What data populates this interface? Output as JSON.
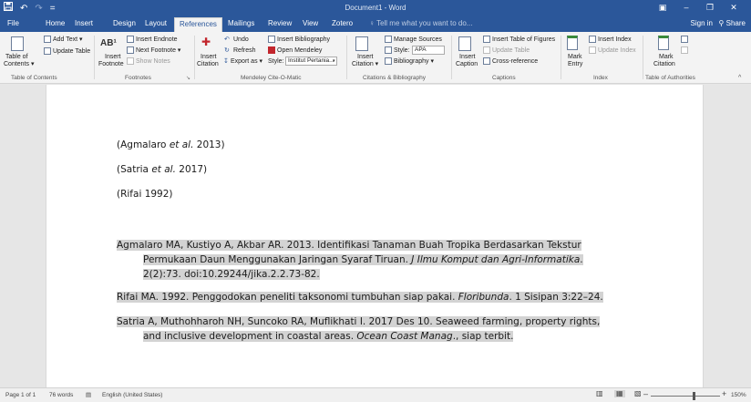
{
  "titlebar": {
    "save_icon": "save-icon",
    "undo_glyph": "↶",
    "redo_glyph": "↷",
    "customize_glyph": "=",
    "title": "Document1 - Word",
    "ribbon_options_glyph": "▣",
    "minimize_glyph": "–",
    "restore_glyph": "❐",
    "close_glyph": "✕"
  },
  "tabs": {
    "items": [
      "File",
      "Home",
      "Insert",
      "Design",
      "Layout",
      "References",
      "Mailings",
      "Review",
      "View",
      "Zotero"
    ],
    "active": "References",
    "tell_me": "Tell me what you want to do...",
    "sign_in": "Sign in",
    "share": "Share"
  },
  "ribbon": {
    "toc": {
      "table_of_contents": "Table of",
      "table_of_contents2": "Contents ▾",
      "add_text": "Add Text ▾",
      "update_table": "Update Table",
      "group_label": "Table of Contents"
    },
    "footnotes": {
      "insert_footnote": "Insert",
      "insert_footnote2": "Footnote",
      "ab_glyph": "AB¹",
      "insert_endnote": "Insert Endnote",
      "next_footnote": "Next Footnote ▾",
      "show_notes": "Show Notes",
      "group_label": "Footnotes"
    },
    "mendeley": {
      "insert_citation": "Insert",
      "insert_citation2": "Citation",
      "undo": "Undo",
      "refresh": "Refresh",
      "export_as": "Export as ▾",
      "insert_bibliography": "Insert Bibliography",
      "open_mendeley": "Open Mendeley",
      "style_label": "Style:",
      "style_value": "Institut Pertania...",
      "group_label": "Mendeley Cite-O-Matic"
    },
    "citations": {
      "insert_citation": "Insert",
      "insert_citation2": "Citation ▾",
      "manage_sources": "Manage Sources",
      "style_label": "Style:",
      "style_value": "APA",
      "bibliography": "Bibliography ▾",
      "group_label": "Citations & Bibliography"
    },
    "captions": {
      "insert_caption": "Insert",
      "insert_caption2": "Caption",
      "insert_table_of_figures": "Insert Table of Figures",
      "update_table": "Update Table",
      "cross_reference": "Cross-reference",
      "group_label": "Captions"
    },
    "index": {
      "mark_entry": "Mark",
      "mark_entry2": "Entry",
      "insert_index": "Insert Index",
      "update_index": "Update Index",
      "group_label": "Index"
    },
    "authorities": {
      "mark_citation": "Mark",
      "mark_citation2": "Citation",
      "group_label": "Table of Authorities"
    },
    "collapse_glyph": "^"
  },
  "document": {
    "citations": [
      {
        "pre": "(Agmalaro ",
        "em": "et al.",
        "post": " 2013)"
      },
      {
        "pre": "(Satria ",
        "em": "et al.",
        "post": " 2017)"
      },
      {
        "pre": "(Rifai 1992)",
        "em": "",
        "post": ""
      }
    ],
    "bib1": {
      "l1": "Agmalaro MA, Kustiyo A, Akbar AR. 2013. Identifikasi Tanaman Buah Tropika Berdasarkan Tekstur",
      "l2_pre": "Permukaan Daun Menggunakan Jaringan Syaraf Tiruan. ",
      "l2_em": "J Ilmu Komput dan Agri-Informatika",
      "l2_post": ".",
      "l3": "2(2):73. doi:10.29244/jika.2.2.73-82."
    },
    "bib2": {
      "pre": "Rifai MA. 1992. Penggodokan peneliti taksonomi tumbuhan siap pakai. ",
      "em": "Floribunda",
      "post": ". 1 Sisipan 3:22–24."
    },
    "bib3": {
      "l1": "Satria A, Muthohharoh NH, Suncoko RA, Muflikhati I. 2017 Des 10. Seaweed farming, property rights,",
      "l2_pre": "and inclusive development in coastal areas. ",
      "l2_em": "Ocean Coast Manag",
      "l2_post": "., siap terbit."
    }
  },
  "status": {
    "page": "Page 1 of 1",
    "words": "76 words",
    "language": "English (United States)",
    "zoom_minus": "–",
    "zoom_plus": "+",
    "zoom": "150%"
  }
}
